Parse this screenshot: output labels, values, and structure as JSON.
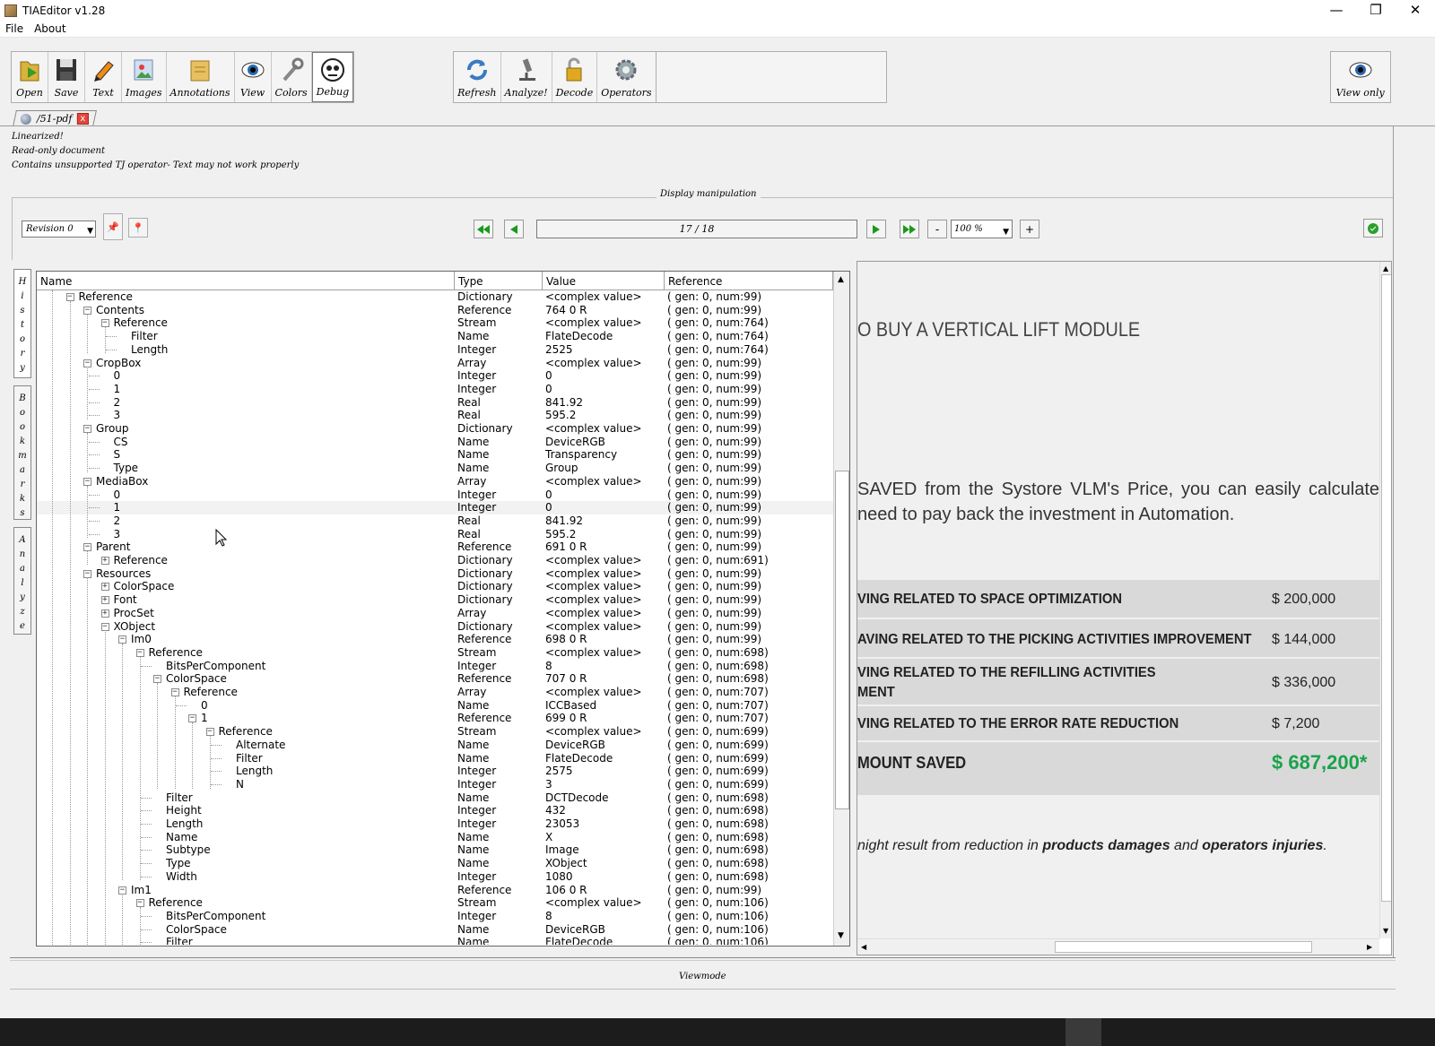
{
  "window": {
    "title": "TIAEditor v1.28",
    "controls": [
      "—",
      "❐",
      "✕"
    ]
  },
  "menu": [
    "File",
    "About"
  ],
  "toolbar": {
    "group1": [
      {
        "label": "Open",
        "icon": "folder-open-icon"
      },
      {
        "label": "Save",
        "icon": "floppy-disk-icon"
      },
      {
        "label": "Text",
        "icon": "pencil-icon"
      },
      {
        "label": "Images",
        "icon": "image-icon"
      },
      {
        "label": "Annotations",
        "icon": "note-icon"
      },
      {
        "label": "View",
        "icon": "eye-icon"
      },
      {
        "label": "Colors",
        "icon": "tools-icon"
      },
      {
        "label": "Debug",
        "icon": "bug-icon"
      }
    ],
    "group2": [
      {
        "label": "Refresh",
        "icon": "refresh-icon"
      },
      {
        "label": "Analyze!",
        "icon": "microscope-icon"
      },
      {
        "label": "Decode",
        "icon": "padlock-icon"
      },
      {
        "label": "Operators",
        "icon": "gear-icon"
      }
    ],
    "group3": [
      {
        "label": "View only",
        "icon": "eye-icon"
      }
    ]
  },
  "document_tab": {
    "name": "/51-pdf",
    "close": "x"
  },
  "messages": [
    "Linearized!",
    "Read-only document",
    "Contains unsupported TJ operator- Text may not work properly"
  ],
  "display_manipulation": {
    "label": "Display manipulation",
    "revision": "Revision 0",
    "page": "17 / 18",
    "zoom": "100 %",
    "zoom_minus": "-",
    "zoom_plus": "+"
  },
  "side_tabs": [
    {
      "label": "History"
    },
    {
      "label": "Bookmarks"
    },
    {
      "label": "Analyze"
    }
  ],
  "tree": {
    "columns": [
      "Name",
      "Type",
      "Value",
      "Reference"
    ],
    "rows": [
      {
        "n": "Reference",
        "d": 5,
        "e": "-",
        "t": "Dictionary",
        "v": "<complex value>",
        "r": "( gen: 0, num:99)"
      },
      {
        "n": "Contents",
        "d": 6,
        "e": "-",
        "t": "Reference",
        "v": "764 0 R",
        "r": "( gen: 0, num:99)"
      },
      {
        "n": "Reference",
        "d": 7,
        "e": "-",
        "t": "Stream",
        "v": "<complex value>",
        "r": "( gen: 0, num:764)"
      },
      {
        "n": "Filter",
        "d": 8,
        "e": "",
        "t": "Name",
        "v": "FlateDecode",
        "r": "( gen: 0, num:764)"
      },
      {
        "n": "Length",
        "d": 8,
        "e": "",
        "t": "Integer",
        "v": "2525",
        "r": "( gen: 0, num:764)"
      },
      {
        "n": "CropBox",
        "d": 6,
        "e": "-",
        "t": "Array",
        "v": "<complex value>",
        "r": "( gen: 0, num:99)"
      },
      {
        "n": "0",
        "d": 7,
        "e": "",
        "t": "Integer",
        "v": "0",
        "r": "( gen: 0, num:99)"
      },
      {
        "n": "1",
        "d": 7,
        "e": "",
        "t": "Integer",
        "v": "0",
        "r": "( gen: 0, num:99)"
      },
      {
        "n": "2",
        "d": 7,
        "e": "",
        "t": "Real",
        "v": "841.92",
        "r": "( gen: 0, num:99)"
      },
      {
        "n": "3",
        "d": 7,
        "e": "",
        "t": "Real",
        "v": "595.2",
        "r": "( gen: 0, num:99)"
      },
      {
        "n": "Group",
        "d": 6,
        "e": "-",
        "t": "Dictionary",
        "v": "<complex value>",
        "r": "( gen: 0, num:99)"
      },
      {
        "n": "CS",
        "d": 7,
        "e": "",
        "t": "Name",
        "v": "DeviceRGB",
        "r": "( gen: 0, num:99)"
      },
      {
        "n": "S",
        "d": 7,
        "e": "",
        "t": "Name",
        "v": "Transparency",
        "r": "( gen: 0, num:99)"
      },
      {
        "n": "Type",
        "d": 7,
        "e": "",
        "t": "Name",
        "v": "Group",
        "r": "( gen: 0, num:99)"
      },
      {
        "n": "MediaBox",
        "d": 6,
        "e": "-",
        "t": "Array",
        "v": "<complex value>",
        "r": "( gen: 0, num:99)"
      },
      {
        "n": "0",
        "d": 7,
        "e": "",
        "t": "Integer",
        "v": "0",
        "r": "( gen: 0, num:99)"
      },
      {
        "n": "1",
        "d": 7,
        "e": "",
        "t": "Integer",
        "v": "0",
        "r": "( gen: 0, num:99)",
        "hl": true
      },
      {
        "n": "2",
        "d": 7,
        "e": "",
        "t": "Real",
        "v": "841.92",
        "r": "( gen: 0, num:99)"
      },
      {
        "n": "3",
        "d": 7,
        "e": "",
        "t": "Real",
        "v": "595.2",
        "r": "( gen: 0, num:99)"
      },
      {
        "n": "Parent",
        "d": 6,
        "e": "-",
        "t": "Reference",
        "v": "691 0 R",
        "r": "( gen: 0, num:99)"
      },
      {
        "n": "Reference",
        "d": 7,
        "e": "+",
        "t": "Dictionary",
        "v": "<complex value>",
        "r": "( gen: 0, num:691)"
      },
      {
        "n": "Resources",
        "d": 6,
        "e": "-",
        "t": "Dictionary",
        "v": "<complex value>",
        "r": "( gen: 0, num:99)"
      },
      {
        "n": "ColorSpace",
        "d": 7,
        "e": "+",
        "t": "Dictionary",
        "v": "<complex value>",
        "r": "( gen: 0, num:99)"
      },
      {
        "n": "Font",
        "d": 7,
        "e": "+",
        "t": "Dictionary",
        "v": "<complex value>",
        "r": "( gen: 0, num:99)"
      },
      {
        "n": "ProcSet",
        "d": 7,
        "e": "+",
        "t": "Array",
        "v": "<complex value>",
        "r": "( gen: 0, num:99)"
      },
      {
        "n": "XObject",
        "d": 7,
        "e": "-",
        "t": "Dictionary",
        "v": "<complex value>",
        "r": "( gen: 0, num:99)"
      },
      {
        "n": "Im0",
        "d": 8,
        "e": "-",
        "t": "Reference",
        "v": "698 0 R",
        "r": "( gen: 0, num:99)"
      },
      {
        "n": "Reference",
        "d": 9,
        "e": "-",
        "t": "Stream",
        "v": "<complex value>",
        "r": "( gen: 0, num:698)"
      },
      {
        "n": "BitsPerComponent",
        "d": 10,
        "e": "",
        "t": "Integer",
        "v": "8",
        "r": "( gen: 0, num:698)"
      },
      {
        "n": "ColorSpace",
        "d": 10,
        "e": "-",
        "t": "Reference",
        "v": "707 0 R",
        "r": "( gen: 0, num:698)"
      },
      {
        "n": "Reference",
        "d": 11,
        "e": "-",
        "t": "Array",
        "v": "<complex value>",
        "r": "( gen: 0, num:707)"
      },
      {
        "n": "0",
        "d": 12,
        "e": "",
        "t": "Name",
        "v": "ICCBased",
        "r": "( gen: 0, num:707)"
      },
      {
        "n": "1",
        "d": 12,
        "e": "-",
        "t": "Reference",
        "v": "699 0 R",
        "r": "( gen: 0, num:707)"
      },
      {
        "n": "Reference",
        "d": 13,
        "e": "-",
        "t": "Stream",
        "v": "<complex value>",
        "r": "( gen: 0, num:699)"
      },
      {
        "n": "Alternate",
        "d": 14,
        "e": "",
        "t": "Name",
        "v": "DeviceRGB",
        "r": "( gen: 0, num:699)"
      },
      {
        "n": "Filter",
        "d": 14,
        "e": "",
        "t": "Name",
        "v": "FlateDecode",
        "r": "( gen: 0, num:699)"
      },
      {
        "n": "Length",
        "d": 14,
        "e": "",
        "t": "Integer",
        "v": "2575",
        "r": "( gen: 0, num:699)"
      },
      {
        "n": "N",
        "d": 14,
        "e": "",
        "t": "Integer",
        "v": "3",
        "r": "( gen: 0, num:699)"
      },
      {
        "n": "Filter",
        "d": 10,
        "e": "",
        "t": "Name",
        "v": "DCTDecode",
        "r": "( gen: 0, num:698)"
      },
      {
        "n": "Height",
        "d": 10,
        "e": "",
        "t": "Integer",
        "v": "432",
        "r": "( gen: 0, num:698)"
      },
      {
        "n": "Length",
        "d": 10,
        "e": "",
        "t": "Integer",
        "v": "23053",
        "r": "( gen: 0, num:698)"
      },
      {
        "n": "Name",
        "d": 10,
        "e": "",
        "t": "Name",
        "v": "X",
        "r": "( gen: 0, num:698)"
      },
      {
        "n": "Subtype",
        "d": 10,
        "e": "",
        "t": "Name",
        "v": "Image",
        "r": "( gen: 0, num:698)"
      },
      {
        "n": "Type",
        "d": 10,
        "e": "",
        "t": "Name",
        "v": "XObject",
        "r": "( gen: 0, num:698)"
      },
      {
        "n": "Width",
        "d": 10,
        "e": "",
        "t": "Integer",
        "v": "1080",
        "r": "( gen: 0, num:698)"
      },
      {
        "n": "Im1",
        "d": 8,
        "e": "-",
        "t": "Reference",
        "v": "106 0 R",
        "r": "( gen: 0, num:99)"
      },
      {
        "n": "Reference",
        "d": 9,
        "e": "-",
        "t": "Stream",
        "v": "<complex value>",
        "r": "( gen: 0, num:106)"
      },
      {
        "n": "BitsPerComponent",
        "d": 10,
        "e": "",
        "t": "Integer",
        "v": "8",
        "r": "( gen: 0, num:106)"
      },
      {
        "n": "ColorSpace",
        "d": 10,
        "e": "",
        "t": "Name",
        "v": "DeviceRGB",
        "r": "( gen: 0, num:106)"
      },
      {
        "n": "Filter",
        "d": 10,
        "e": "",
        "t": "Name",
        "v": "FlateDecode",
        "r": "( gen: 0, num:106)"
      }
    ]
  },
  "preview": {
    "heading": "O BUY A VERTICAL LIFT MODULE",
    "paragraph": "SAVED from the Systore VLM's Price, you can easily calculate need to pay back the investment in Automation.",
    "rows": [
      {
        "label": "VING RELATED TO SPACE OPTIMIZATION",
        "amount": "$ 200,000"
      },
      {
        "label": "AVING RELATED TO THE PICKING ACTIVITIES IMPROVEMENT",
        "amount": "$ 144,000"
      },
      {
        "label": "VING RELATED TO THE REFILLING ACTIVITIES\nMENT",
        "amount": "$ 336,000"
      },
      {
        "label": "VING RELATED TO THE ERROR RATE REDUCTION",
        "amount": "$ 7,200"
      },
      {
        "label": "MOUNT SAVED",
        "amount": "$ 687,200*",
        "total": true
      }
    ],
    "note_start": "night result from reduction in ",
    "note_b1": "products damages",
    "note_mid": " and ",
    "note_b2": "operators injuries",
    "note_end": ".",
    "total_color": "#1aa34a"
  },
  "status": {
    "viewmode": "Viewmode"
  }
}
